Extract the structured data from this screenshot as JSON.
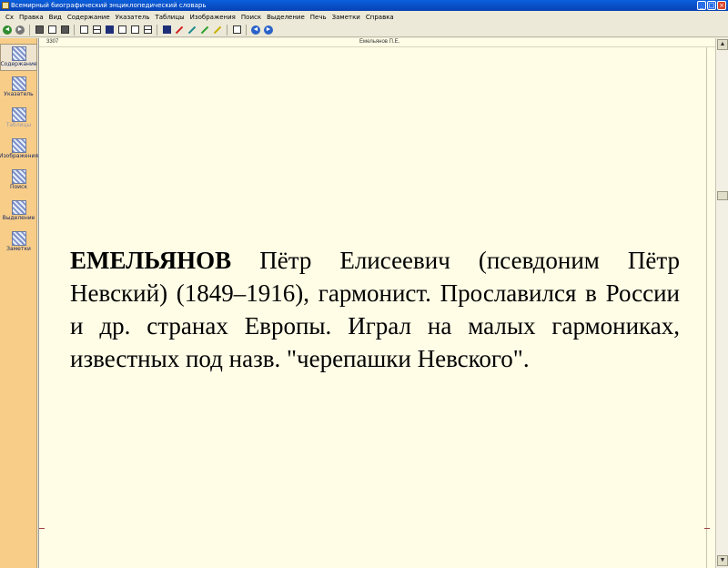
{
  "window": {
    "title": "Всемирный биографический энциклопедический словарь",
    "minimize": "_",
    "maximize": "□",
    "close": "×"
  },
  "menu": [
    "Сх",
    "Правка",
    "Вид",
    "Содержание",
    "Указатель",
    "Таблицы",
    "Изображения",
    "Поиск",
    "Выделение",
    "Печь",
    "Заметки",
    "Справка"
  ],
  "toolbar": {
    "back": "◄",
    "forward": "►",
    "nav_prev": "◄",
    "nav_next": "►"
  },
  "sidebar": {
    "items": [
      {
        "label": "Содержание",
        "icon": "contents-icon"
      },
      {
        "label": "Указатель",
        "icon": "index-icon"
      },
      {
        "label": "Таблицы",
        "icon": "tables-icon"
      },
      {
        "label": "Изображения",
        "icon": "images-icon"
      },
      {
        "label": "Поиск",
        "icon": "search-icon"
      },
      {
        "label": "Выделение",
        "icon": "highlight-icon"
      },
      {
        "label": "Заметки",
        "icon": "notes-icon"
      }
    ]
  },
  "doc": {
    "page_number": "3307",
    "running_header": "Емельянов П.Е.",
    "headword": "ЕМЕЛЬЯНОВ",
    "body": " Пётр Елисеевич (псевдоним Пётр Невский) (1849–1916), гармонист. Прославился в России и др. странах Европы. Играл на малых гармониках, известных под назв. \"черепашки Невского\"."
  },
  "scrollbar": {
    "up": "▲",
    "down": "▼"
  },
  "colors": {
    "sidebar_bg": "#f8cd88",
    "page_bg": "#fffde6",
    "titlebar": "#0a5fdc"
  }
}
